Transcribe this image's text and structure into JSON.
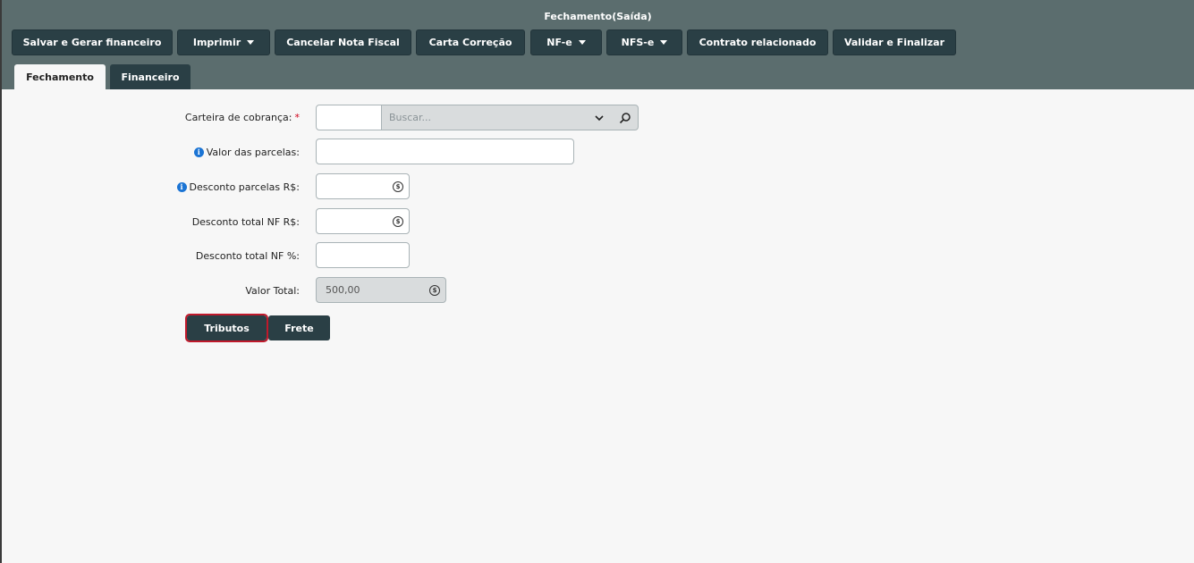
{
  "window": {
    "title": "Fechamento(Saída)"
  },
  "toolbar": {
    "buttons": [
      {
        "label": "Salvar e Gerar financeiro",
        "dropdown": false
      },
      {
        "label": "Imprimir",
        "dropdown": true
      },
      {
        "label": "Cancelar Nota Fiscal",
        "dropdown": false
      },
      {
        "label": "Carta Correção",
        "dropdown": false
      },
      {
        "label": "NF-e",
        "dropdown": true
      },
      {
        "label": "NFS-e",
        "dropdown": true
      },
      {
        "label": "Contrato relacionado",
        "dropdown": false
      },
      {
        "label": "Validar e Finalizar",
        "dropdown": false
      }
    ]
  },
  "tabs": [
    {
      "label": "Fechamento",
      "active": true
    },
    {
      "label": "Financeiro",
      "active": false
    }
  ],
  "form": {
    "carteira": {
      "label": "Carteira de cobrança:",
      "required_mark": "*",
      "code_value": "",
      "placeholder": "Buscar..."
    },
    "valor_parcelas": {
      "label": "Valor das parcelas:",
      "value": ""
    },
    "desconto_parcelas": {
      "label": "Desconto parcelas R$:",
      "value": ""
    },
    "desconto_total_nf": {
      "label": "Desconto total NF R$:",
      "value": ""
    },
    "desconto_total_pct": {
      "label": "Desconto total NF %:",
      "value": ""
    },
    "valor_total": {
      "label": "Valor Total:",
      "value": "500,00"
    }
  },
  "actions": {
    "tributos_label": "Tributos",
    "frete_label": "Frete"
  },
  "colors": {
    "header_bg": "#5b6d6e",
    "button_bg": "#2a3f45",
    "required": "#d0021b",
    "info": "#1b74d4",
    "focus_outline": "#c0192b"
  },
  "icons": {
    "info": "info-icon",
    "coin": "coin-icon",
    "chevron": "chevron-down-icon",
    "search": "search-icon",
    "caret": "caret-down-icon"
  }
}
